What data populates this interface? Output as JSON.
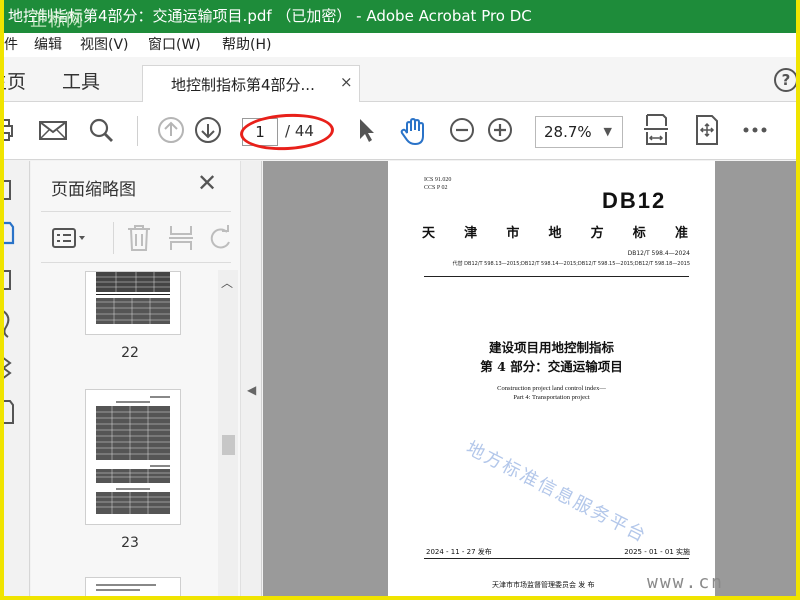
{
  "window": {
    "title": "地控制指标第4部分：交通运输项目.pdf （已加密） - Adobe Acrobat Pro DC",
    "watermark": "正标网"
  },
  "menu": [
    "件",
    "编辑",
    "视图(V)",
    "窗口(W)",
    "帮助(H)"
  ],
  "nav": {
    "home": "主页",
    "tools": "工具",
    "doc_tab": "地控制指标第4部分...",
    "close": "×",
    "help": "?"
  },
  "toolbar": {
    "current_page": "1",
    "total_pages": "/ 44",
    "zoom": "28.7%",
    "zoom_caret": "▼",
    "icons": [
      "print-icon",
      "email-icon",
      "search-icon",
      "prev-page-icon",
      "next-page-icon",
      "select-arrow-icon",
      "hand-icon",
      "zoom-out-icon",
      "zoom-in-icon",
      "fit-page-icon",
      "fit-width-icon",
      "more-icon"
    ]
  },
  "thumbnails_panel": {
    "title": "页面缩略图",
    "close": "✕",
    "pages": [
      "22",
      "23"
    ]
  },
  "document": {
    "ics": "ICS  91.020",
    "ccs": "CCS  P 02",
    "db_code": "DB12",
    "standard_type": [
      "天",
      "津",
      "市",
      "地",
      "方",
      "标",
      "准"
    ],
    "std_number": "DB12/T 598.4—2024",
    "replaces": "代替 DB12/T 598.13—2015;DB12/T 598.14—2015;DB12/T 598.15—2015;DB12/T 598.18—2015",
    "title_line1": "建设项目用地控制指标",
    "title_line2": "第 4 部分：交通运输项目",
    "en_title_line1": "Construction project land control index—",
    "en_title_line2": "Part 4: Transportation project",
    "watermark": "地方标准信息服务平台",
    "publish_date": "2024 - 11 - 27 发布",
    "implement_date": "2025 - 01 - 01 实施",
    "issuer": "天津市市场监督管理委员会    发  布"
  },
  "corner_watermark": "www.cn",
  "colors": {
    "title_bar": "#1e8c3a",
    "frame": "#f0e400",
    "annotation": "#e8201a",
    "hand_tool": "#2a73c8"
  }
}
